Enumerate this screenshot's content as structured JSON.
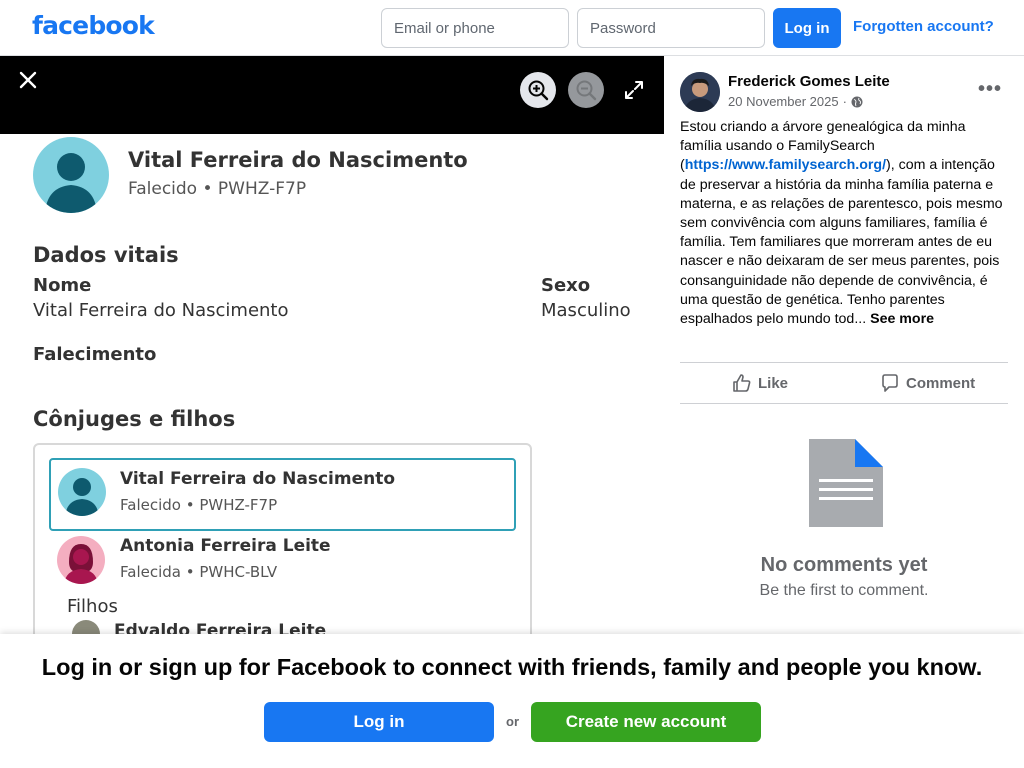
{
  "header": {
    "logo": "facebook",
    "email_placeholder": "Email or phone",
    "password_placeholder": "Password",
    "login_label": "Log in",
    "forgot_label": "Forgotten account?"
  },
  "viewer": {
    "profile": {
      "name": "Vital Ferreira do Nascimento",
      "status": "Falecido • PWHZ-F7P"
    },
    "vitals": {
      "heading": "Dados vitais",
      "name_label": "Nome",
      "name_value": "Vital Ferreira do Nascimento",
      "sex_label": "Sexo",
      "sex_value": "Masculino",
      "death_label": "Falecimento"
    },
    "family": {
      "heading": "Cônjuges e filhos",
      "spouse1_name": "Vital Ferreira do Nascimento",
      "spouse1_status": "Falecido • PWHZ-F7P",
      "spouse2_name": "Antonia Ferreira Leite",
      "spouse2_status": "Falecida • PWHC-BLV",
      "children_label": "Filhos",
      "child1_name": "Edvaldo Ferreira Leite"
    }
  },
  "post": {
    "author": "Frederick Gomes Leite",
    "date": "20 November 2025",
    "text_before_link": "Estou criando a árvore genealógica da minha família usando o FamilySearch (",
    "link": "https://www.familysearch.org/",
    "text_after_link": "), com a intenção de preservar a história da minha família paterna e materna, e as relações de parentesco, pois mesmo sem convivência com alguns familiares, família é família. Tem familiares que morreram antes de eu nascer e não deixaram de ser meus parentes, pois consanguinidade não depende de convivência, é uma questão de genética. Tenho parentes espalhados pelo mundo tod...",
    "see_more": "See more",
    "like_label": "Like",
    "comment_label": "Comment",
    "no_comments": "No comments yet",
    "no_comments_sub": "Be the first to comment."
  },
  "banner": {
    "text": "Log in or sign up for Facebook to connect with friends, family and people you know.",
    "login_label": "Log in",
    "or_label": "or",
    "create_label": "Create new account"
  },
  "colors": {
    "brand_blue": "#1877f2",
    "create_green": "#36a420",
    "selection_teal": "#2fa0b6"
  }
}
